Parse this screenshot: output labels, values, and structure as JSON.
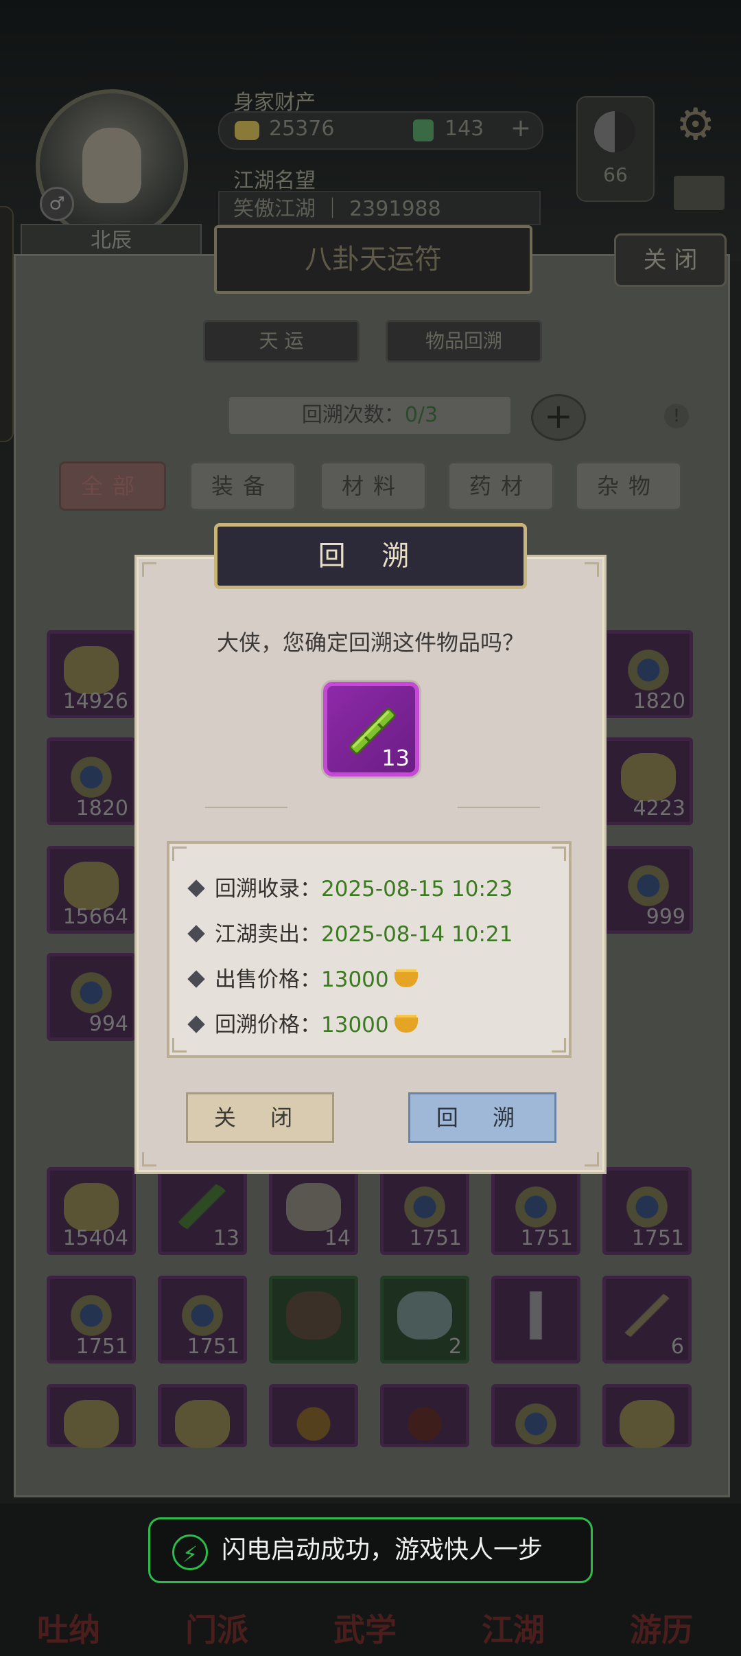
{
  "header": {
    "wealth_label": "身家财产",
    "gold": "25376",
    "jade": "143",
    "reputation_label": "江湖名望",
    "reputation_title": "笑傲江湖",
    "reputation_value": "2391988",
    "player_name": "北辰",
    "taiji_value": "66"
  },
  "panel": {
    "title": "八卦天运符",
    "close_label": "关 闭",
    "tabs": [
      "天 运",
      "物品回溯"
    ],
    "count_label": "回溯次数：",
    "count_value": "0/3",
    "filters": [
      "全部",
      "装备",
      "材料",
      "药材",
      "杂物"
    ]
  },
  "grid": {
    "visible_left": [
      "14926",
      "1820",
      "15664",
      "994"
    ],
    "visible_right": [
      "1820",
      "4223",
      "999"
    ],
    "row_a": [
      "15404",
      "13",
      "14",
      "1751",
      "1751",
      "1751"
    ],
    "row_b": [
      "1751",
      "1751",
      "",
      "2",
      "",
      "6"
    ]
  },
  "dialog": {
    "title": "回 溯",
    "question": "大侠，您确定回溯这件物品吗？",
    "item_count": "13",
    "info": [
      {
        "label": "回溯收录：",
        "value": "2025-08-15 10:23"
      },
      {
        "label": "江湖卖出：",
        "value": "2025-08-14 10:21"
      },
      {
        "label": "出售价格：",
        "value": "13000"
      },
      {
        "label": "回溯价格：",
        "value": "13000"
      }
    ],
    "close_button": "关 闭",
    "confirm_button": "回 溯"
  },
  "nav": [
    "吐纳",
    "门派",
    "武学",
    "江湖",
    "游历"
  ],
  "toast": "闪电启动成功，游戏快人一步",
  "colors": {
    "accent_green": "#3c7a22",
    "rarity_purple": "#8d2aa8",
    "confirm_blue": "#9fb8d8",
    "toast_border": "#2dbb4a"
  }
}
